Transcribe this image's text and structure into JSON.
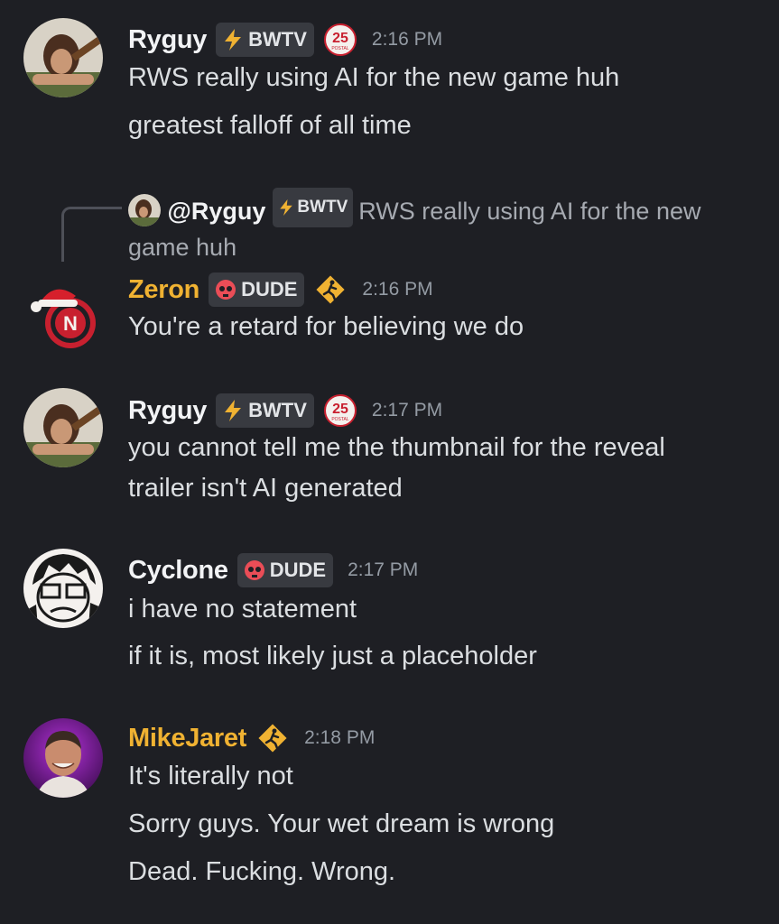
{
  "messages": [
    {
      "author": "Ryguy",
      "tag": "BWTV",
      "badge_text": "25",
      "badge_sub": "POSTAL",
      "time": "2:16 PM",
      "lines": [
        "RWS really using AI for the new game huh",
        "greatest falloff of all time"
      ]
    },
    {
      "reply": {
        "mention": "@Ryguy",
        "tag": "BWTV",
        "text_1": "RWS really using AI for the new",
        "text_2": "game huh"
      },
      "author": "Zeron",
      "tag": "DUDE",
      "time": "2:16 PM",
      "lines": [
        "You're a retard for believing we do"
      ]
    },
    {
      "author": "Ryguy",
      "tag": "BWTV",
      "badge_text": "25",
      "badge_sub": "POSTAL",
      "time": "2:17 PM",
      "lines": [
        "you cannot tell me the thumbnail for the reveal",
        "trailer isn't AI generated"
      ]
    },
    {
      "author": "Cyclone",
      "tag": "DUDE",
      "time": "2:17 PM",
      "lines": [
        "i have no statement",
        "if it is, most likely just a placeholder"
      ]
    },
    {
      "author": "MikeJaret",
      "time": "2:18 PM",
      "lines": [
        "It's literally not",
        "Sorry guys. Your wet dream is wrong",
        "Dead. Fucking. Wrong."
      ]
    }
  ],
  "colors": {
    "background": "#1e1f24",
    "name_default": "#f2f3f5",
    "name_gold": "#f0b232",
    "text": "#dbdee1",
    "muted": "#949ba4"
  },
  "icons": {
    "bwtv_tag": "lightning-icon",
    "dude_tag": "skull-icon",
    "postal_badge": "postal-25-badge",
    "hazard_badge": "running-man-warning-icon"
  }
}
